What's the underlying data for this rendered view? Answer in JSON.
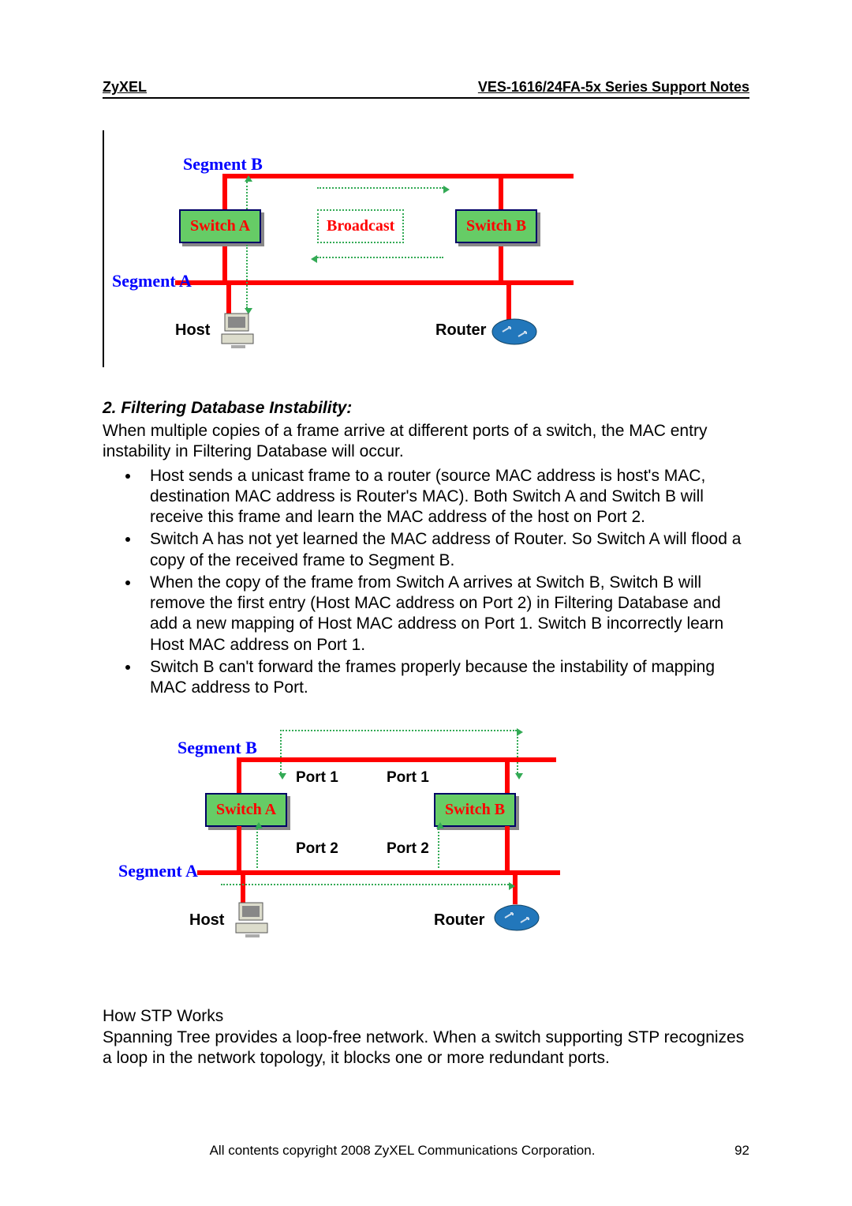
{
  "header": {
    "left": "ZyXEL",
    "right": "VES-1616/24FA-5x Series Support Notes"
  },
  "diagram1": {
    "segmentB": "Segment B",
    "segmentA": "Segment A",
    "switchA": "Switch A",
    "switchB": "Switch B",
    "broadcast": "Broadcast",
    "host": "Host",
    "router": "Router"
  },
  "section2": {
    "title": "2. Filtering Database Instability:",
    "intro": "When multiple copies of a frame arrive at different ports of a switch, the MAC entry instability in Filtering Database will occur.",
    "bullets": [
      "Host sends a unicast frame to a router (source MAC address is host's MAC, destination MAC address is Router's MAC). Both Switch A and Switch B will receive this frame and learn the MAC address of the host on Port 2.",
      "Switch A has not yet learned the MAC address of Router. So Switch A will flood a copy of the received frame to Segment B.",
      "When the copy of the frame from Switch A arrives at Switch B, Switch B will remove the first entry (Host MAC address on Port 2) in Filtering Database and add a new mapping of Host MAC address on Port 1. Switch B incorrectly learn Host MAC address on Port 1.",
      "Switch B can't forward the frames properly because the instability of mapping MAC address to Port."
    ]
  },
  "diagram2": {
    "segmentB": "Segment B",
    "segmentA": "Segment A",
    "switchA": "Switch A",
    "switchB": "Switch B",
    "port1a": "Port 1",
    "port1b": "Port 1",
    "port2a": "Port 2",
    "port2b": "Port 2",
    "host": "Host",
    "router": "Router"
  },
  "howstp": {
    "title": "How STP Works",
    "body": "Spanning Tree provides a loop-free network. When a switch supporting STP recognizes a loop in the network topology, it blocks one or more redundant ports."
  },
  "footer": {
    "copyright": "All contents copyright 2008 ZyXEL Communications Corporation.",
    "page": "92"
  }
}
